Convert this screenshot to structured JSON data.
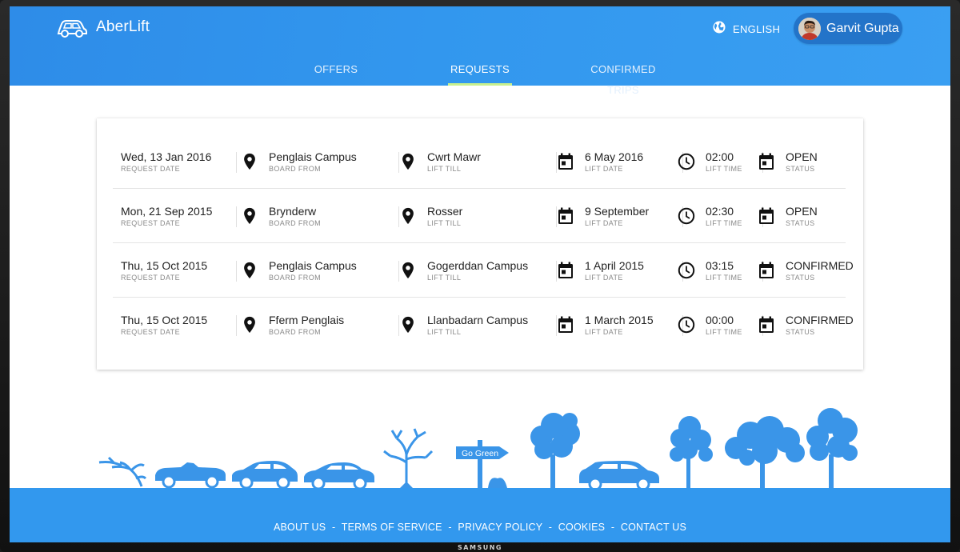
{
  "app": {
    "name": "AberLift"
  },
  "header": {
    "language": "ENGLISH",
    "user_name": "Garvit Gupta"
  },
  "tabs": [
    {
      "label": "OFFERS",
      "active": false
    },
    {
      "label": "REQUESTS",
      "active": true
    },
    {
      "label": "CONFIRMED TRIPS",
      "active": false
    }
  ],
  "labels": {
    "request_date": "REQUEST DATE",
    "board_from": "BOARD FROM",
    "lift_till": "LIFT TILL",
    "lift_date": "LIFT DATE",
    "lift_time": "LIFT TIME",
    "status": "STATUS"
  },
  "requests": [
    {
      "request_date": "Wed, 13 Jan 2016",
      "board_from": "Penglais Campus",
      "lift_till": "Cwrt Mawr",
      "lift_date": "6 May 2016",
      "lift_time": "02:00",
      "status": "OPEN"
    },
    {
      "request_date": "Mon, 21 Sep 2015",
      "board_from": "Brynderw",
      "lift_till": "Rosser",
      "lift_date": "9 September",
      "lift_time": "02:30",
      "status": "OPEN"
    },
    {
      "request_date": "Thu, 15 Oct 2015",
      "board_from": "Penglais Campus",
      "lift_till": "Gogerddan Campus",
      "lift_date": "1 April 2015",
      "lift_time": "03:15",
      "status": "CONFIRMED"
    },
    {
      "request_date": "Thu, 15 Oct 2015",
      "board_from": "Fferm Penglais",
      "lift_till": "Llanbadarn Campus",
      "lift_date": "1 March 2015",
      "lift_time": "00:00",
      "status": "CONFIRMED"
    }
  ],
  "scenery": {
    "sign_text": "Go Green"
  },
  "footer": {
    "links": [
      "ABOUT US",
      "TERMS OF SERVICE",
      "PRIVACY POLICY",
      "COOKIES",
      "CONTACT US"
    ],
    "separator": "-"
  },
  "device_brand": "SAMSUNG",
  "colors": {
    "primary": "#3298ee",
    "tab_indicator": "#c7f08f",
    "scenery": "#3a95e8"
  },
  "icons": {
    "logo": "car-outline-icon",
    "language": "globe-icon",
    "board_from": "map-pin-icon",
    "lift_till": "map-pin-icon",
    "lift_date": "calendar-icon",
    "lift_time": "clock-icon",
    "status": "calendar-icon"
  }
}
